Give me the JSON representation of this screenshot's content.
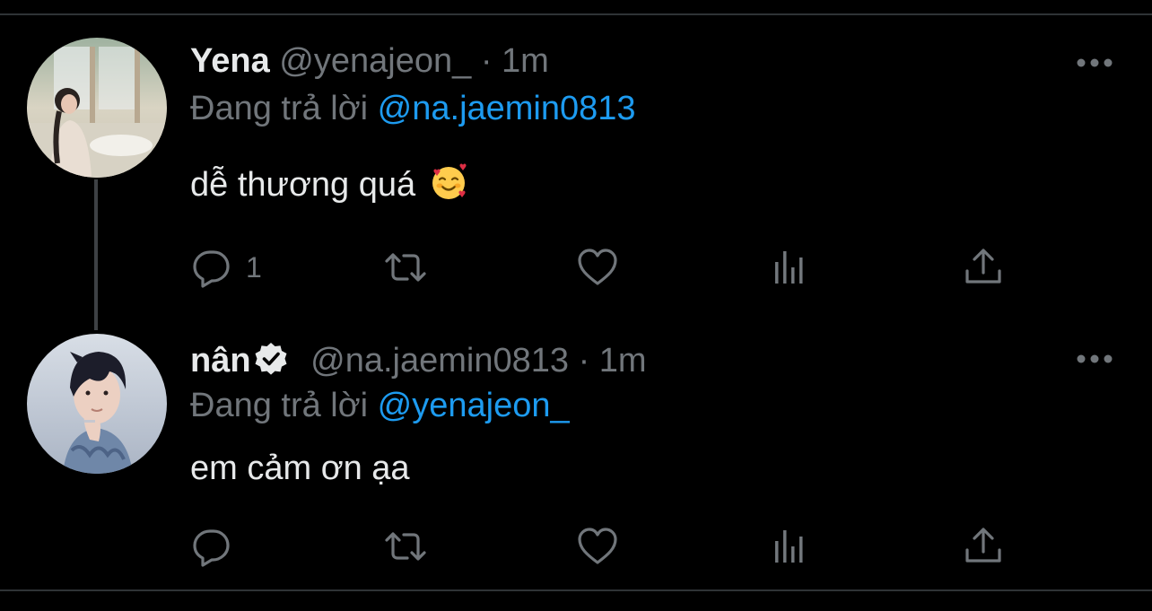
{
  "colors": {
    "background": "#000000",
    "primary_text": "#e7e9ea",
    "secondary_text": "#71767b",
    "accent_link": "#1d9bf0",
    "divider": "#2f3336",
    "thread_line": "#3e4144"
  },
  "tweets": [
    {
      "display_name": "Yena",
      "verified": false,
      "handle": "@yenajeon_",
      "separator": "·",
      "time": "1m",
      "replying_prefix": "Đang trả lời",
      "replying_to": "@na.jaemin0813",
      "text": "dễ thương quá",
      "emoji": "smiling-face-with-hearts-icon",
      "reply_count": "1",
      "icons": {
        "reply": "reply-icon",
        "retweet": "retweet-icon",
        "like": "heart-icon",
        "views": "views-icon",
        "share": "share-icon",
        "more": "more-dots-icon"
      }
    },
    {
      "display_name": "nân",
      "verified": true,
      "handle": "@na.jaemin0813",
      "separator": "·",
      "time": "1m",
      "replying_prefix": "Đang trả lời",
      "replying_to": "@yenajeon_",
      "text": "em cảm ơn ạa",
      "reply_count": "",
      "icons": {
        "reply": "reply-icon",
        "retweet": "retweet-icon",
        "like": "heart-icon",
        "views": "views-icon",
        "share": "share-icon",
        "more": "more-dots-icon",
        "verified": "verified-badge-icon"
      }
    }
  ]
}
